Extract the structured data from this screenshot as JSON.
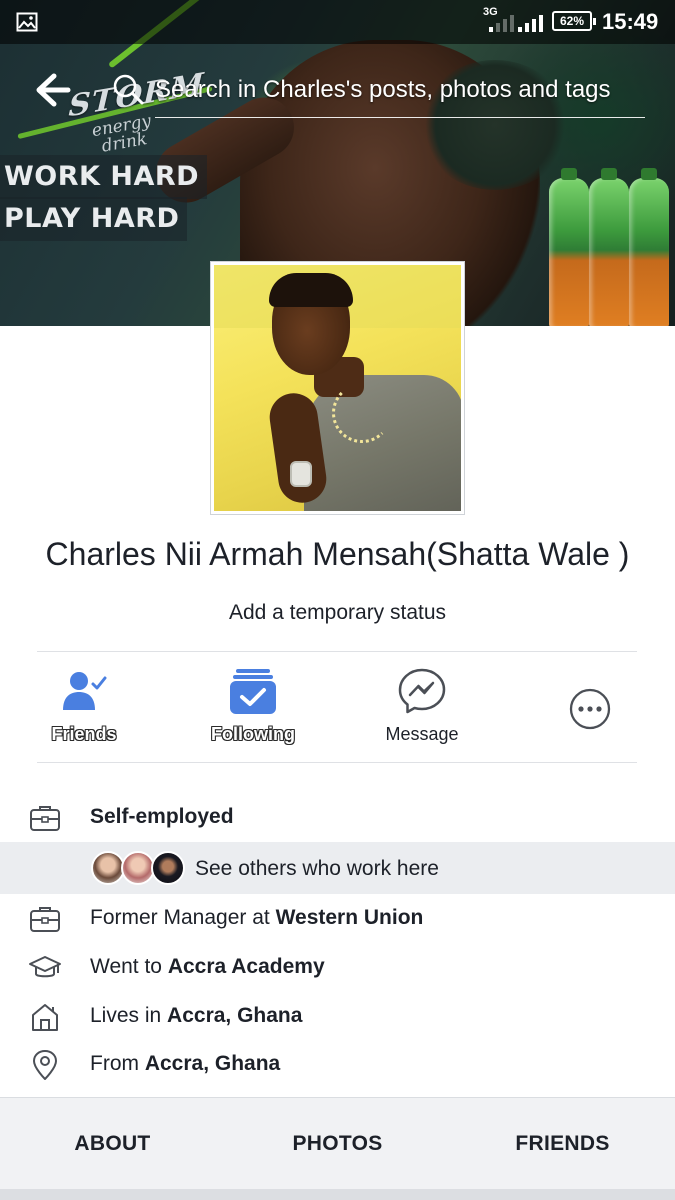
{
  "status_bar": {
    "network": "3G",
    "battery": "62%",
    "time": "15:49",
    "gallery_icon": "image-icon"
  },
  "cover": {
    "brand_name": "STORM",
    "brand_sub": "energy drink",
    "slogan_line1": "WORK HARD",
    "slogan_line2": "PLAY HARD"
  },
  "search": {
    "back_icon": "arrow-left-icon",
    "search_icon": "search-icon",
    "placeholder": "Search in Charles's posts, photos and tags"
  },
  "profile": {
    "name": "Charles Nii Armah Mensah",
    "nickname": "(Shatta Wale )",
    "temporary_status": "Add a temporary status"
  },
  "actions": [
    {
      "label": "Friends",
      "icon": "friend-check-icon"
    },
    {
      "label": "Following",
      "icon": "following-check-icon"
    },
    {
      "label": "Message",
      "icon": "messenger-icon"
    },
    {
      "label": "",
      "icon": "more-options-icon"
    }
  ],
  "about": {
    "work_current": {
      "icon": "briefcase-icon",
      "text": "Self-employed"
    },
    "coworkers": {
      "text": "See others who work here"
    },
    "work_former": {
      "icon": "briefcase-icon",
      "prefix": "Former Manager at ",
      "bold": "Western Union"
    },
    "education": {
      "icon": "graduation-cap-icon",
      "prefix": "Went to ",
      "bold": "Accra Academy"
    },
    "lives": {
      "icon": "home-icon",
      "prefix": "Lives in ",
      "bold": "Accra, Ghana"
    },
    "from": {
      "icon": "location-pin-icon",
      "prefix": "From ",
      "bold": "Accra, Ghana"
    }
  },
  "tabs": [
    "ABOUT",
    "PHOTOS",
    "FRIENDS"
  ],
  "colors": {
    "accent": "#4a7fe0",
    "text": "#1d2129",
    "icon_gray": "#4b4f56",
    "highlight_row": "#ebedf0"
  }
}
